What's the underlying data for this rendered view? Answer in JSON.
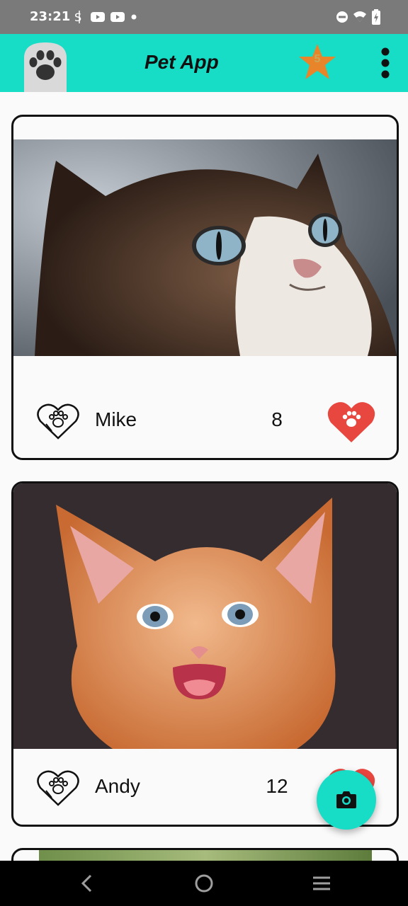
{
  "status_bar": {
    "time": "23:21",
    "left_icons": [
      "data-saver-icon",
      "youtube-icon",
      "youtube-icon",
      "dot-icon"
    ],
    "right_icons": [
      "do-not-disturb-icon",
      "wifi-icon",
      "battery-charging-icon"
    ]
  },
  "app_bar": {
    "title": "Pet App",
    "background": "#17dcc6",
    "star_count": "5",
    "star_color": "#e8842a"
  },
  "pets": [
    {
      "name": "Mike",
      "likes": "8",
      "liked": true,
      "photo": "grumpy-cat-photo"
    },
    {
      "name": "Andy",
      "likes": "12",
      "liked": true,
      "photo": "orange-kitten-photo"
    },
    {
      "name": "",
      "likes": "",
      "liked": false,
      "photo": "green-photo-partial"
    }
  ],
  "like_color": "#e8473f",
  "fab": {
    "icon": "camera-icon"
  },
  "nav_bar": {
    "icons": [
      "back-icon",
      "home-icon",
      "recents-icon"
    ]
  }
}
